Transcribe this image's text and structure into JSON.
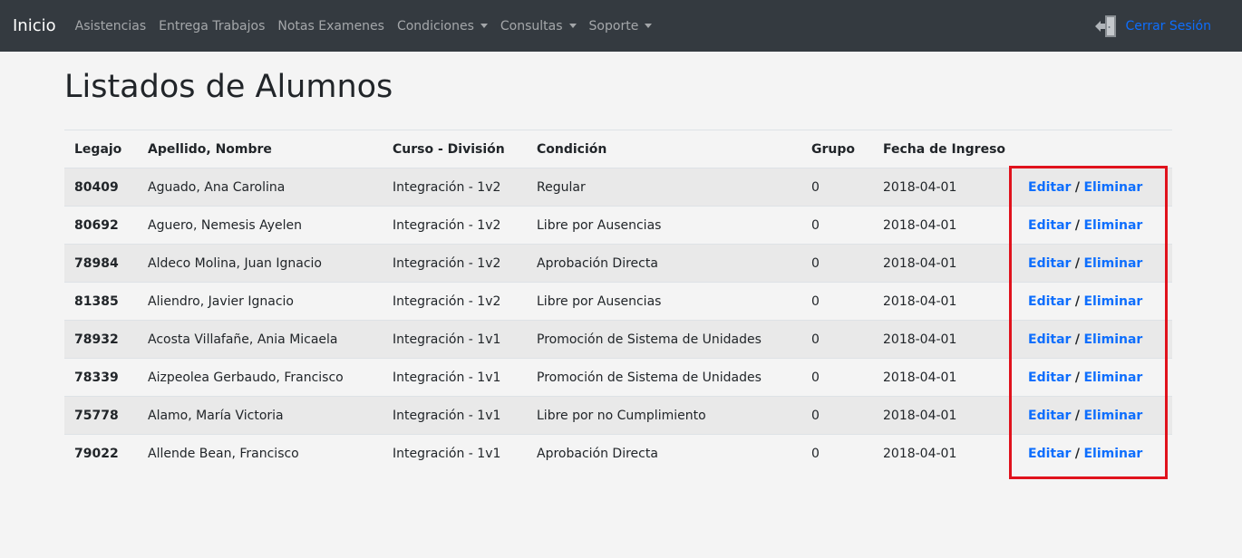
{
  "navbar": {
    "brand": "Inicio",
    "links": [
      {
        "label": "Asistencias",
        "dropdown": false
      },
      {
        "label": "Entrega Trabajos",
        "dropdown": false
      },
      {
        "label": "Notas Examenes",
        "dropdown": false
      },
      {
        "label": "Condiciones",
        "dropdown": true
      },
      {
        "label": "Consultas",
        "dropdown": true
      },
      {
        "label": "Soporte",
        "dropdown": true
      }
    ],
    "logout_label": "Cerrar Sesión",
    "logout_icon": "door-exit-icon"
  },
  "page": {
    "title": "Listados de Alumnos"
  },
  "table": {
    "headers": [
      "Legajo",
      "Apellido, Nombre",
      "Curso - División",
      "Condición",
      "Grupo",
      "Fecha de Ingreso",
      ""
    ],
    "rows": [
      {
        "legajo": "80409",
        "nombre": "Aguado, Ana Carolina",
        "curso": "Integración - 1v2",
        "condicion": "Regular",
        "grupo": "0",
        "fecha": "2018-04-01"
      },
      {
        "legajo": "80692",
        "nombre": "Aguero, Nemesis Ayelen",
        "curso": "Integración - 1v2",
        "condicion": "Libre por Ausencias",
        "grupo": "0",
        "fecha": "2018-04-01"
      },
      {
        "legajo": "78984",
        "nombre": "Aldeco Molina, Juan Ignacio",
        "curso": "Integración - 1v2",
        "condicion": "Aprobación Directa",
        "grupo": "0",
        "fecha": "2018-04-01"
      },
      {
        "legajo": "81385",
        "nombre": "Aliendro, Javier Ignacio",
        "curso": "Integración - 1v2",
        "condicion": "Libre por Ausencias",
        "grupo": "0",
        "fecha": "2018-04-01"
      },
      {
        "legajo": "78932",
        "nombre": "Acosta Villafañe, Ania Micaela",
        "curso": "Integración - 1v1",
        "condicion": "Promoción de Sistema de Unidades",
        "grupo": "0",
        "fecha": "2018-04-01"
      },
      {
        "legajo": "78339",
        "nombre": "Aizpeolea Gerbaudo, Francisco",
        "curso": "Integración - 1v1",
        "condicion": "Promoción de Sistema de Unidades",
        "grupo": "0",
        "fecha": "2018-04-01"
      },
      {
        "legajo": "75778",
        "nombre": "Alamo, María Victoria",
        "curso": "Integración - 1v1",
        "condicion": "Libre por no Cumplimiento",
        "grupo": "0",
        "fecha": "2018-04-01"
      },
      {
        "legajo": "79022",
        "nombre": "Allende Bean, Francisco",
        "curso": "Integración - 1v1",
        "condicion": "Aprobación Directa",
        "grupo": "0",
        "fecha": "2018-04-01"
      }
    ],
    "action_edit": "Editar",
    "action_separator": "/",
    "action_delete": "Eliminar"
  },
  "colors": {
    "navbar_bg": "#343a40",
    "link_blue": "#0d6efd",
    "highlight_red": "#e0121c",
    "page_bg": "#f4f4f4",
    "striped_row": "#e9e9e9"
  }
}
